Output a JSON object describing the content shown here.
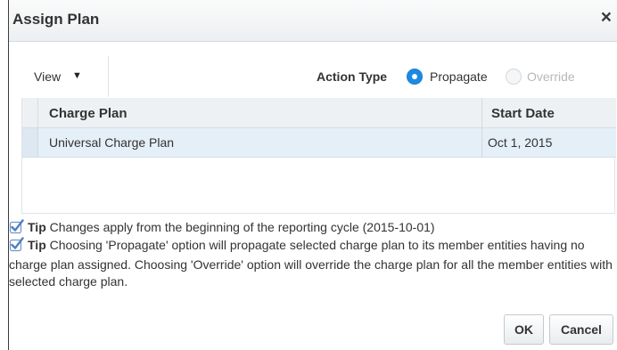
{
  "dialog": {
    "title": "Assign Plan",
    "close_glyph": "×"
  },
  "toolbar": {
    "view_label": "View",
    "view_caret": "▼",
    "action_type_label": "Action Type",
    "options": [
      {
        "label": "Propagate",
        "selected": true
      },
      {
        "label": "Override",
        "selected": false,
        "disabled": true
      }
    ]
  },
  "table": {
    "columns": [
      "Charge Plan",
      "Start Date"
    ],
    "rows": [
      {
        "charge_plan": "Universal Charge Plan",
        "start_date": "Oct 1, 2015",
        "selected": true
      }
    ]
  },
  "tips": [
    {
      "label": "Tip",
      "text": "Changes apply from the beginning of the reporting cycle (2015-10-01)"
    },
    {
      "label": "Tip",
      "text": "Choosing 'Propagate' option will propagate selected charge plan to its member entities having no charge plan assigned. Choosing 'Override' option will override the charge plan for all the member entities with selected charge plan."
    }
  ],
  "buttons": {
    "ok": "OK",
    "cancel": "Cancel"
  },
  "colors": {
    "accent": "#1c8ae2",
    "tip_check": "#4f7fc2",
    "selected_row": "#e5eff8"
  },
  "icons": {
    "close": "close-icon",
    "view_caret": "caret-down-icon",
    "tip": "check-icon"
  }
}
